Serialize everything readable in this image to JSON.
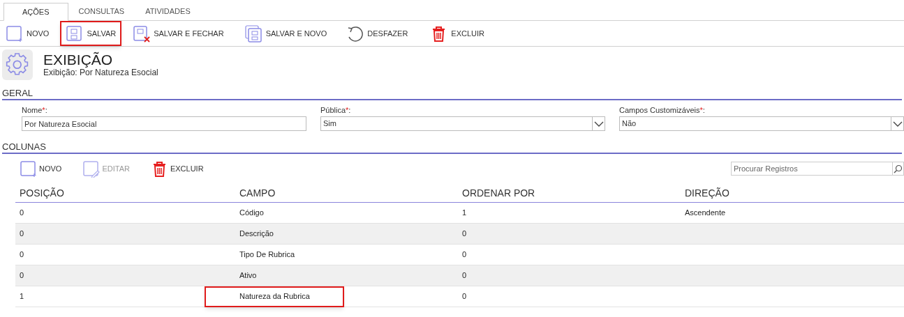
{
  "tabs": [
    {
      "label": "AÇÕES",
      "selected": true
    },
    {
      "label": "CONSULTAS",
      "selected": false
    },
    {
      "label": "ATIVIDADES",
      "selected": false
    }
  ],
  "toolbar": [
    {
      "kind": "new",
      "label": "NOVO",
      "highlighted": false
    },
    {
      "kind": "save",
      "label": "SALVAR",
      "highlighted": true
    },
    {
      "kind": "save_close",
      "label": "SALVAR E FECHAR",
      "highlighted": false
    },
    {
      "kind": "save_new",
      "label": "SALVAR E NOVO",
      "highlighted": false
    },
    {
      "kind": "undo",
      "label": "DESFAZER",
      "highlighted": false
    },
    {
      "kind": "delete",
      "label": "EXCLUIR",
      "highlighted": false
    }
  ],
  "header": {
    "title": "EXIBIÇÃO",
    "subtitle": "Exibição: Por Natureza Esocial"
  },
  "general": {
    "title": "GERAL",
    "fields": [
      {
        "kind": "text",
        "label": "Nome",
        "mark": "*",
        "suffix": ":",
        "value": "Por Natureza Esocial"
      },
      {
        "kind": "select",
        "label": "Pública",
        "mark": "*",
        "suffix": ":",
        "value": "Sim"
      },
      {
        "kind": "select",
        "label": "Campos Customizáveis",
        "mark": "*",
        "suffix": ":",
        "value": "Não"
      }
    ]
  },
  "columns_section": {
    "title": "COLUNAS",
    "toolbar": [
      {
        "kind": "new",
        "label": "NOVO",
        "disabled": false
      },
      {
        "kind": "edit",
        "label": "EDITAR",
        "disabled": true
      },
      {
        "kind": "delete",
        "label": "EXCLUIR",
        "disabled": false
      }
    ],
    "search": {
      "placeholder": "Procurar Registros"
    },
    "table": {
      "columns": [
        "POSIÇÃO",
        "CAMPO",
        "ORDENAR POR",
        "DIREÇÃO"
      ],
      "rows": [
        {
          "cells": [
            "0",
            "Código",
            "1",
            "Ascendente"
          ],
          "highlighted": false
        },
        {
          "cells": [
            "0",
            "Descrição",
            "0",
            null
          ],
          "highlighted": false
        },
        {
          "cells": [
            "0",
            "Tipo De Rubrica",
            "0",
            null
          ],
          "highlighted": false
        },
        {
          "cells": [
            "0",
            "Ativo",
            "0",
            null
          ],
          "highlighted": false
        },
        {
          "cells": [
            "1",
            "Natureza da Rubrica",
            "0",
            null
          ],
          "highlighted": true
        }
      ]
    }
  }
}
